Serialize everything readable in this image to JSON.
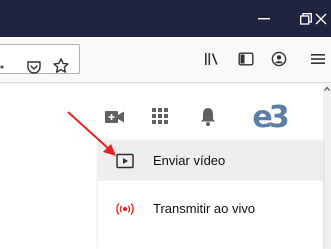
{
  "window": {
    "minimize_glyph": "—",
    "maximize_glyph": "◱",
    "close_glyph": "✕"
  },
  "toolbar": {
    "icons": [
      "pocket-icon",
      "bookmark-star-icon",
      "library-icon",
      "sidebar-icon",
      "account-icon",
      "hamburger-menu-icon"
    ]
  },
  "youtube_header": {
    "avatar_text": "e3"
  },
  "upload_menu": {
    "items": [
      {
        "label": "Enviar vídeo",
        "icon": "upload-video-icon",
        "highlighted": true
      },
      {
        "label": "Transmitir ao vivo",
        "icon": "go-live-icon",
        "highlighted": false
      }
    ]
  },
  "colors": {
    "titlebar": "#202340",
    "annotation_arrow": "#e8231e",
    "live_icon": "#e8231e",
    "avatar": "#5b7fa6"
  }
}
